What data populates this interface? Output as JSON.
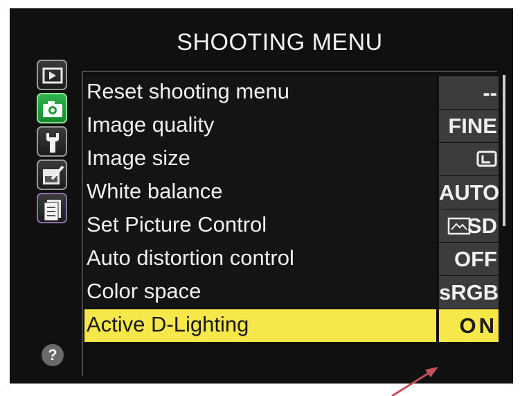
{
  "menu": {
    "title": "SHOOTING MENU",
    "items": [
      {
        "label": "Reset shooting menu",
        "value": "--"
      },
      {
        "label": "Image quality",
        "value": "FINE"
      },
      {
        "label": "Image size",
        "value": ""
      },
      {
        "label": "White balance",
        "value": "AUTO"
      },
      {
        "label": "Set Picture Control",
        "value": "SD"
      },
      {
        "label": "Auto distortion control",
        "value": "OFF"
      },
      {
        "label": "Color space",
        "value": "sRGB"
      },
      {
        "label": "Active D-Lighting",
        "value": "ON"
      }
    ],
    "selected_index": 7
  },
  "tabs": [
    {
      "icon": "playback-icon",
      "active": false
    },
    {
      "icon": "camera-icon",
      "active": true
    },
    {
      "icon": "wrench-icon",
      "active": false
    },
    {
      "icon": "retouch-icon",
      "active": false
    },
    {
      "icon": "recent-settings-icon",
      "active": false
    }
  ],
  "help": {
    "label": "?"
  },
  "colors": {
    "highlight": "#f6e84a",
    "active_tab": "#22a03c",
    "annotation_arrow": "#c0505a"
  }
}
